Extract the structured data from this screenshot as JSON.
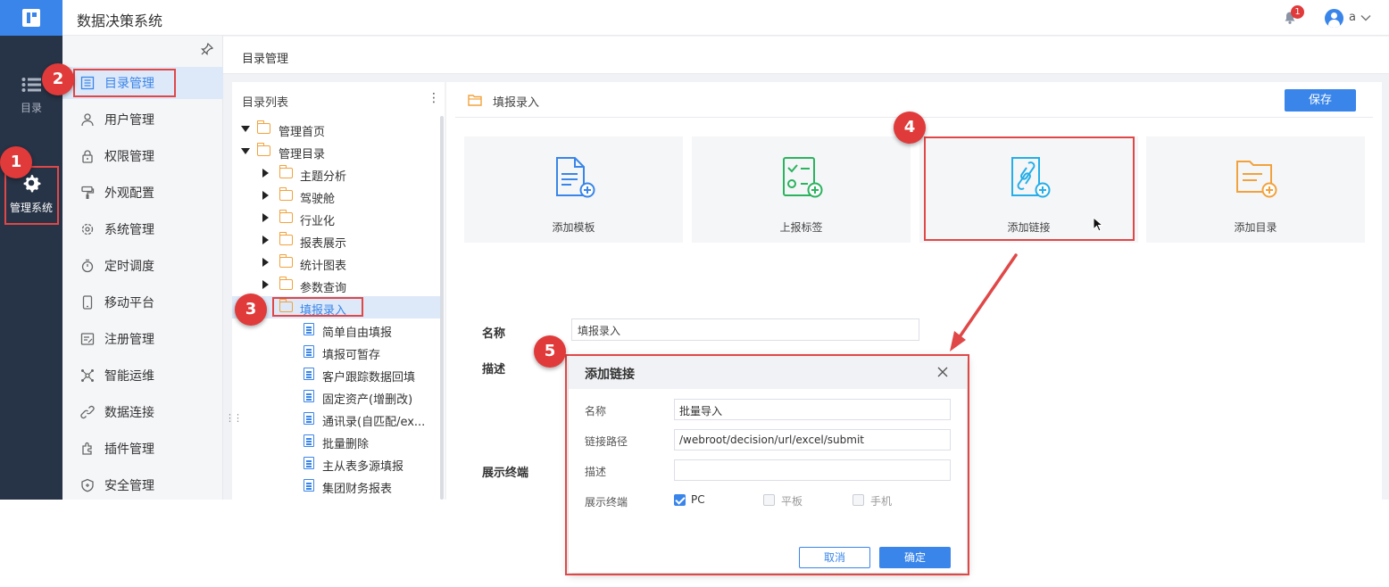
{
  "app": {
    "title": "数据决策系统",
    "notification_count": "1",
    "user_name": "a"
  },
  "rail": [
    {
      "label": "目录",
      "icon": "list-icon"
    },
    {
      "label": "管理系统",
      "icon": "gear-icon"
    }
  ],
  "submenu": [
    {
      "label": "目录管理",
      "icon": "catalog-icon",
      "active": true
    },
    {
      "label": "用户管理",
      "icon": "user-icon"
    },
    {
      "label": "权限管理",
      "icon": "lock-icon"
    },
    {
      "label": "外观配置",
      "icon": "brush-icon"
    },
    {
      "label": "系统管理",
      "icon": "settings-icon"
    },
    {
      "label": "定时调度",
      "icon": "timer-icon"
    },
    {
      "label": "移动平台",
      "icon": "mobile-icon"
    },
    {
      "label": "注册管理",
      "icon": "register-icon"
    },
    {
      "label": "智能运维",
      "icon": "network-icon"
    },
    {
      "label": "数据连接",
      "icon": "link-icon"
    },
    {
      "label": "插件管理",
      "icon": "plugin-icon"
    },
    {
      "label": "安全管理",
      "icon": "shield-icon"
    }
  ],
  "breadcrumb": "目录管理",
  "tree": {
    "header": "目录列表",
    "items": [
      {
        "label": "管理首页",
        "type": "folder",
        "level": 0,
        "expander": "down"
      },
      {
        "label": "管理目录",
        "type": "folder",
        "level": 0,
        "expander": "down"
      },
      {
        "label": "主题分析",
        "type": "folder",
        "level": 1,
        "expander": "right"
      },
      {
        "label": "驾驶舱",
        "type": "folder",
        "level": 1,
        "expander": "right"
      },
      {
        "label": "行业化",
        "type": "folder",
        "level": 1,
        "expander": "right"
      },
      {
        "label": "报表展示",
        "type": "folder",
        "level": 1,
        "expander": "right"
      },
      {
        "label": "统计图表",
        "type": "folder",
        "level": 1,
        "expander": "right"
      },
      {
        "label": "参数查询",
        "type": "folder",
        "level": 1,
        "expander": "right"
      },
      {
        "label": "填报录入",
        "type": "folder",
        "level": 1,
        "expander": "none",
        "selected": true
      },
      {
        "label": "简单自由填报",
        "type": "doc",
        "level": 2
      },
      {
        "label": "填报可暂存",
        "type": "doc",
        "level": 2
      },
      {
        "label": "客户跟踪数据回填",
        "type": "doc",
        "level": 2
      },
      {
        "label": "固定资产(增删改)",
        "type": "doc",
        "level": 2
      },
      {
        "label": "通讯录(自匹配/ex...",
        "type": "doc",
        "level": 2
      },
      {
        "label": "批量删除",
        "type": "doc",
        "level": 2
      },
      {
        "label": "主从表多源填报",
        "type": "doc",
        "level": 2
      },
      {
        "label": "集团财务报表",
        "type": "doc",
        "level": 2
      }
    ]
  },
  "panel": {
    "title": "填报录入",
    "save_label": "保存",
    "cards": [
      {
        "label": "添加模板",
        "icon": "template-add-icon",
        "color": "#3985ea"
      },
      {
        "label": "上报标签",
        "icon": "checklist-add-icon",
        "color": "#2bb35d"
      },
      {
        "label": "添加链接",
        "icon": "link-add-icon",
        "color": "#25aee8"
      },
      {
        "label": "添加目录",
        "icon": "folder-add-icon",
        "color": "#f2a23c"
      }
    ],
    "form": {
      "name_label": "名称",
      "name_value": "填报录入",
      "desc_label": "描述",
      "terminal_label": "展示终端"
    }
  },
  "dialog": {
    "title": "添加链接",
    "name_label": "名称",
    "name_value": "批量导入",
    "path_label": "链接路径",
    "path_value": "/webroot/decision/url/excel/submit",
    "desc_label": "描述",
    "desc_value": "",
    "terminal_label": "展示终端",
    "terminals": [
      {
        "label": "PC",
        "checked": true
      },
      {
        "label": "平板",
        "checked": false
      },
      {
        "label": "手机",
        "checked": false
      }
    ],
    "cancel_label": "取消",
    "ok_label": "确定"
  },
  "annotations": {
    "steps": [
      "1",
      "2",
      "3",
      "4",
      "5"
    ],
    "color": "#e03a3a"
  }
}
